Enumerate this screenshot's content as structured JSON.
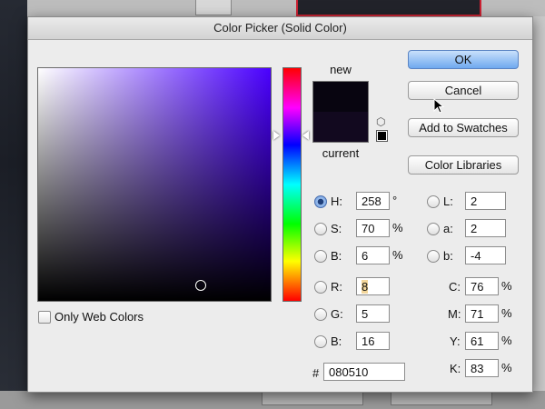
{
  "dialog": {
    "title": "Color Picker (Solid Color)"
  },
  "preview": {
    "new_label": "new",
    "current_label": "current",
    "new_color": "#080510",
    "current_color": "#12091f"
  },
  "buttons": {
    "ok": "OK",
    "cancel": "Cancel",
    "add_to_swatches": "Add to Swatches",
    "color_libraries": "Color Libraries"
  },
  "hsb": {
    "h": {
      "label": "H:",
      "value": "258",
      "unit": "°"
    },
    "s": {
      "label": "S:",
      "value": "70",
      "unit": "%"
    },
    "b": {
      "label": "B:",
      "value": "6",
      "unit": "%"
    }
  },
  "rgb": {
    "r": {
      "label": "R:",
      "value": "8"
    },
    "g": {
      "label": "G:",
      "value": "5"
    },
    "b": {
      "label": "B:",
      "value": "16"
    }
  },
  "lab": {
    "l": {
      "label": "L:",
      "value": "2"
    },
    "a": {
      "label": "a:",
      "value": "2"
    },
    "b": {
      "label": "b:",
      "value": "-4"
    }
  },
  "cmyk": {
    "c": {
      "label": "C:",
      "value": "76",
      "unit": "%"
    },
    "m": {
      "label": "M:",
      "value": "71",
      "unit": "%"
    },
    "y": {
      "label": "Y:",
      "value": "61",
      "unit": "%"
    },
    "k": {
      "label": "K:",
      "value": "83",
      "unit": "%"
    }
  },
  "hex": {
    "label": "#",
    "value": "080510"
  },
  "only_web_colors": "Only Web Colors",
  "colors": {
    "field_hue": "#4a00ff",
    "default_button": "#6fa9ef"
  }
}
